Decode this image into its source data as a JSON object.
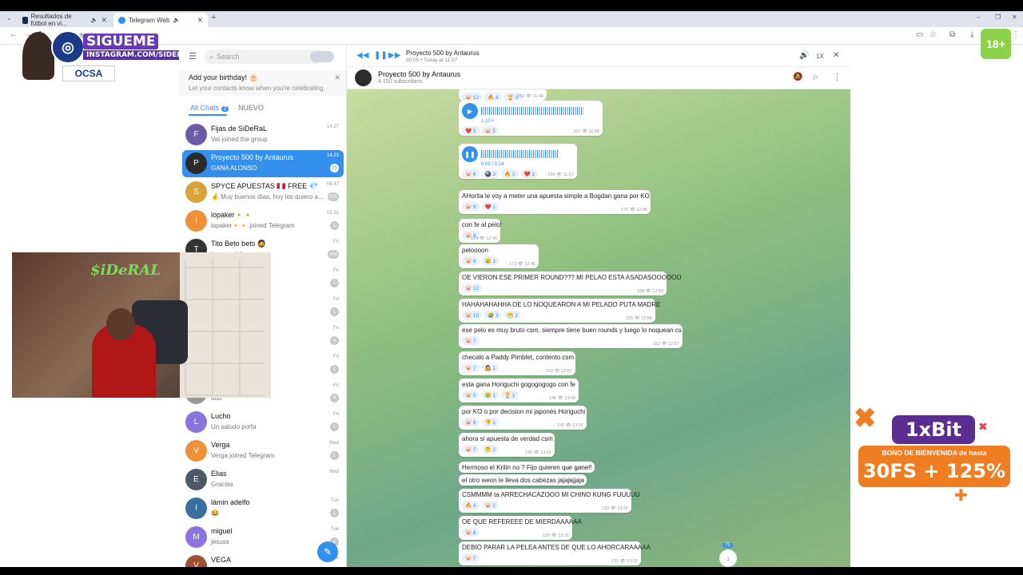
{
  "browser": {
    "tabs": [
      {
        "label": "Resultados de fútbol en vi..."
      },
      {
        "label": "Telegram Web"
      }
    ],
    "url": "web.telegram.org"
  },
  "overlay": {
    "follow_line1": "SIGUEME",
    "follow_line2": "INSTAGRAM.COM/SIDERAL",
    "brand": "OCSA",
    "age_badge": "18+"
  },
  "sidebar": {
    "search_placeholder": "Search",
    "birthday_title": "Add your birthday! 🎂",
    "birthday_sub": "Let your contacts know when you're celebrating.",
    "folders": [
      {
        "label": "All Chats",
        "count": "2"
      },
      {
        "label": "NUEVO"
      }
    ],
    "chats": [
      {
        "name": "Fijas de SiDeRaL",
        "msg": "Val joined the group",
        "time": "14:27",
        "badge": "",
        "color": "#6c5ca8",
        "initial": "F"
      },
      {
        "name": "Proyecto 500 by Antaurus",
        "msg": "GANA ALONSO",
        "time": "14:23",
        "badge": "75",
        "color": "#2b2b2b",
        "initial": "P"
      },
      {
        "name": "SPYCE APUESTAS 🇵🇪 FREE 💎",
        "msg": "🤞 Muy buenos días, hoy los quiero a...",
        "time": "06:47",
        "badge": "635",
        "color": "#d9a33a",
        "initial": "S"
      },
      {
        "name": "lopaker🔸🔸",
        "msg": "lopaker🔸🔸 joined Telegram",
        "time": "03:32",
        "badge": "1",
        "color": "#f0913a",
        "initial": "l"
      },
      {
        "name": "Tito Beto bets 🧔",
        "msg": "betano chile, p...",
        "time": "Fri",
        "badge": "494",
        "color": "#333",
        "initial": "T"
      },
      {
        "name": "",
        "msg": "",
        "time": "Fri",
        "badge": "1",
        "color": "#999",
        "initial": ""
      },
      {
        "name": "",
        "msg": "nde estarás vendi...",
        "time": "Fri",
        "badge": "1",
        "color": "#999",
        "initial": ""
      },
      {
        "name": "",
        "msg": "smre",
        "time": "Fri",
        "badge": "4",
        "color": "#999",
        "initial": ""
      },
      {
        "name": "",
        "msg": "",
        "time": "Fri",
        "badge": "1",
        "color": "#999",
        "initial": ""
      },
      {
        "name": "",
        "msg": "uuu",
        "time": "Fri",
        "badge": "4",
        "color": "#999",
        "initial": ""
      },
      {
        "name": "Lucho",
        "msg": "Un saludo porfa",
        "time": "Fri",
        "badge": "1",
        "color": "#8b74e0",
        "initial": "L"
      },
      {
        "name": "Verga",
        "msg": "Verga joined Telegram",
        "time": "Wed",
        "badge": "1",
        "color": "#f0913a",
        "initial": "V"
      },
      {
        "name": "Elias",
        "msg": "Gracias",
        "time": "Wed",
        "badge": "",
        "color": "#4a5a6a",
        "initial": "E"
      },
      {
        "name": "lámin adelfo",
        "msg": "😂",
        "time": "Tue",
        "badge": "1",
        "color": "#3a6fa0",
        "initial": "l"
      },
      {
        "name": "miguel",
        "msg": "jesuss",
        "time": "Tue",
        "badge": "1",
        "color": "#8b74e0",
        "initial": "M"
      },
      {
        "name": "VEGA",
        "msg": "",
        "time": "Tue",
        "badge": "",
        "color": "#a05030",
        "initial": "V"
      }
    ]
  },
  "player": {
    "title": "Proyecto 500 by Antaurus",
    "sub": "00:05 • Today at 11:57",
    "speed": "1X"
  },
  "chat": {
    "title": "Proyecto 500 by Antaurus",
    "subscribers": "4 150 subscribers",
    "unread": "75",
    "messages": [
      {
        "type": "react",
        "reacts": [
          "🐷 12",
          "🔥 4",
          "🏆 1"
        ],
        "meta": "252 👁 11:49"
      },
      {
        "type": "voice",
        "dur": "1:10 •",
        "reacts": [
          "❤️ 5",
          "🐷 5"
        ],
        "meta": "237 👁 11:56"
      },
      {
        "type": "voice",
        "dur": "0:05 / 0:24",
        "reacts": [
          "🐷 6",
          "🎱 3",
          "🔥 2",
          "❤️ 1"
        ],
        "meta": "238 👁 11:57"
      },
      {
        "type": "text",
        "text": "AHorita le voy a meter una apuesta simple a Bogdan gana por KO",
        "reacts": [
          "🐷 9",
          "❤️ 1"
        ],
        "meta": "175 👁 12:45"
      },
      {
        "type": "text",
        "text": "con fe al pelo!",
        "reacts": [
          "🐷 8"
        ],
        "meta": "174 👁 12:46"
      },
      {
        "type": "text",
        "text": "peloooon",
        "reacts": [
          "🐷 6",
          "😢 1"
        ],
        "meta": "173 👁 12:46"
      },
      {
        "type": "text",
        "text": "OE VIERON ESE PRIMER ROUND??? MI PELAO ESTA ASADASOOOOOO",
        "reacts": [
          "🐷 12"
        ],
        "meta": "158 👁 12:53"
      },
      {
        "type": "text",
        "text": "HAHAHAHAHHA OE LO NOQUEARON A MI PELADO PUTA MADRE",
        "reacts": [
          "🐷 10",
          "🤣 3",
          "😁 2"
        ],
        "meta": "155 👁 12:56"
      },
      {
        "type": "text",
        "text": "ese pelo es muy bruto csm, siempre tiene buen rounds y luego lo noquean cs",
        "reacts": [
          "🐷 7"
        ],
        "meta": "152 👁 12:57"
      },
      {
        "type": "text",
        "text": "checalo a Paddy Pimblet, contento csm",
        "reacts": [
          "🐷 7",
          "🤷 1"
        ],
        "meta": "150 👁 12:57"
      },
      {
        "type": "text",
        "text": "esta gana Horiguchi gogogogogo con fe",
        "reacts": [
          "🐷 5",
          "😢 1",
          "🏆 1"
        ],
        "meta": "146 👁 13:00"
      },
      {
        "type": "text",
        "text": "por KO o por decision mi japonés Horiguchi",
        "reacts": [
          "🐷 8",
          "👎 1"
        ],
        "meta": "143 👁 13:01"
      },
      {
        "type": "text",
        "text": "ahora si apuesta de verdad csm",
        "reacts": [
          "🐷 7",
          "🤔 2"
        ],
        "meta": "142 👁 13:01"
      },
      {
        "type": "text",
        "text": "Hermoso el Krilin no ? Fijo quieren que gane!!",
        "reacts": [],
        "meta": "113 👁 13:22"
      },
      {
        "type": "text",
        "text": "el otro weon le lleva dos cabezas jajajajjaja",
        "reacts": [],
        "meta": "112 👁 13:22"
      },
      {
        "type": "text",
        "text": "CSMMMM ta ARRECHACAZOOO MI CHINO KUNG FUUUUU",
        "reacts": [
          "🔥 4",
          "🐷 2"
        ],
        "meta": "133 👁 13:26"
      },
      {
        "type": "text",
        "text": "OE QUE REFEREEE DE MIERDAAAAAA",
        "reacts": [
          "🐷 6"
        ],
        "meta": "129 👁 13:31"
      },
      {
        "type": "text",
        "text": "DEBIO PARAR LA PELEA ANTES DE QUE LO AHORCARAAAAA",
        "reacts": [
          "🐷 7"
        ],
        "meta": "131 👁 13:31"
      }
    ]
  },
  "ad": {
    "brand": "1xBit",
    "line1": "BONO DE BIENVENIDA de hasta",
    "line2": "30FS + 125%"
  },
  "colors": {
    "accent": "#3390ec",
    "ad_orange": "#ef7d22",
    "ad_purple": "#5b2d91"
  }
}
